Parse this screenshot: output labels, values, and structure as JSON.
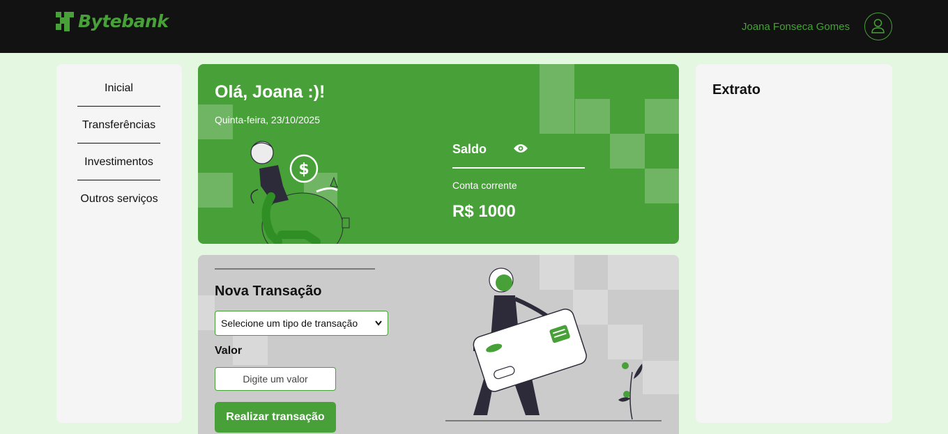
{
  "header": {
    "brand": "Bytebank",
    "username": "Joana Fonseca Gomes",
    "brand_color": "#47a138",
    "bar_color": "#121212",
    "avatar_icon": "user-icon"
  },
  "sidebar": {
    "items": [
      {
        "label": "Inicial"
      },
      {
        "label": "Transferências"
      },
      {
        "label": "Investimentos"
      },
      {
        "label": "Outros serviços"
      }
    ]
  },
  "welcome": {
    "greeting": "Olá, Joana :)!",
    "date": "Quinta-feira, 23/10/2025",
    "balance_label": "Saldo",
    "balance_toggle_icon": "eye-icon",
    "account_label": "Conta corrente",
    "balance_value": "R$ 1000"
  },
  "transaction": {
    "title": "Nova Transação",
    "type_select": "Selecione um tipo de transação",
    "value_label": "Valor",
    "value_placeholder": "Digite um valor",
    "submit_label": "Realizar transação"
  },
  "statement": {
    "title": "Extrato"
  }
}
